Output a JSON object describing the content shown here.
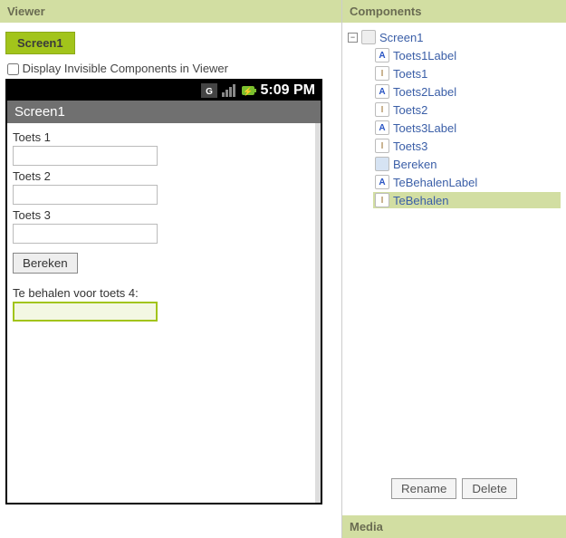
{
  "viewer": {
    "header": "Viewer",
    "screen_tab": "Screen1",
    "invisible_checkbox_label": "Display Invisible Components in Viewer",
    "statusbar_time": "5:09 PM",
    "phone_title": "Screen1",
    "labels": {
      "toets1": "Toets 1",
      "toets2": "Toets 2",
      "toets3": "Toets 3",
      "tebehalen": "Te behalen voor toets 4:"
    },
    "button_bereken": "Bereken"
  },
  "components": {
    "header": "Components",
    "root": "Screen1",
    "items": [
      {
        "name": "Toets1Label",
        "type": "label"
      },
      {
        "name": "Toets1",
        "type": "text"
      },
      {
        "name": "Toets2Label",
        "type": "label"
      },
      {
        "name": "Toets2",
        "type": "text"
      },
      {
        "name": "Toets3Label",
        "type": "label"
      },
      {
        "name": "Toets3",
        "type": "text"
      },
      {
        "name": "Bereken",
        "type": "button"
      },
      {
        "name": "TeBehalenLabel",
        "type": "label"
      },
      {
        "name": "TeBehalen",
        "type": "text",
        "selected": true
      }
    ],
    "rename_button": "Rename",
    "delete_button": "Delete"
  },
  "media": {
    "header": "Media"
  }
}
